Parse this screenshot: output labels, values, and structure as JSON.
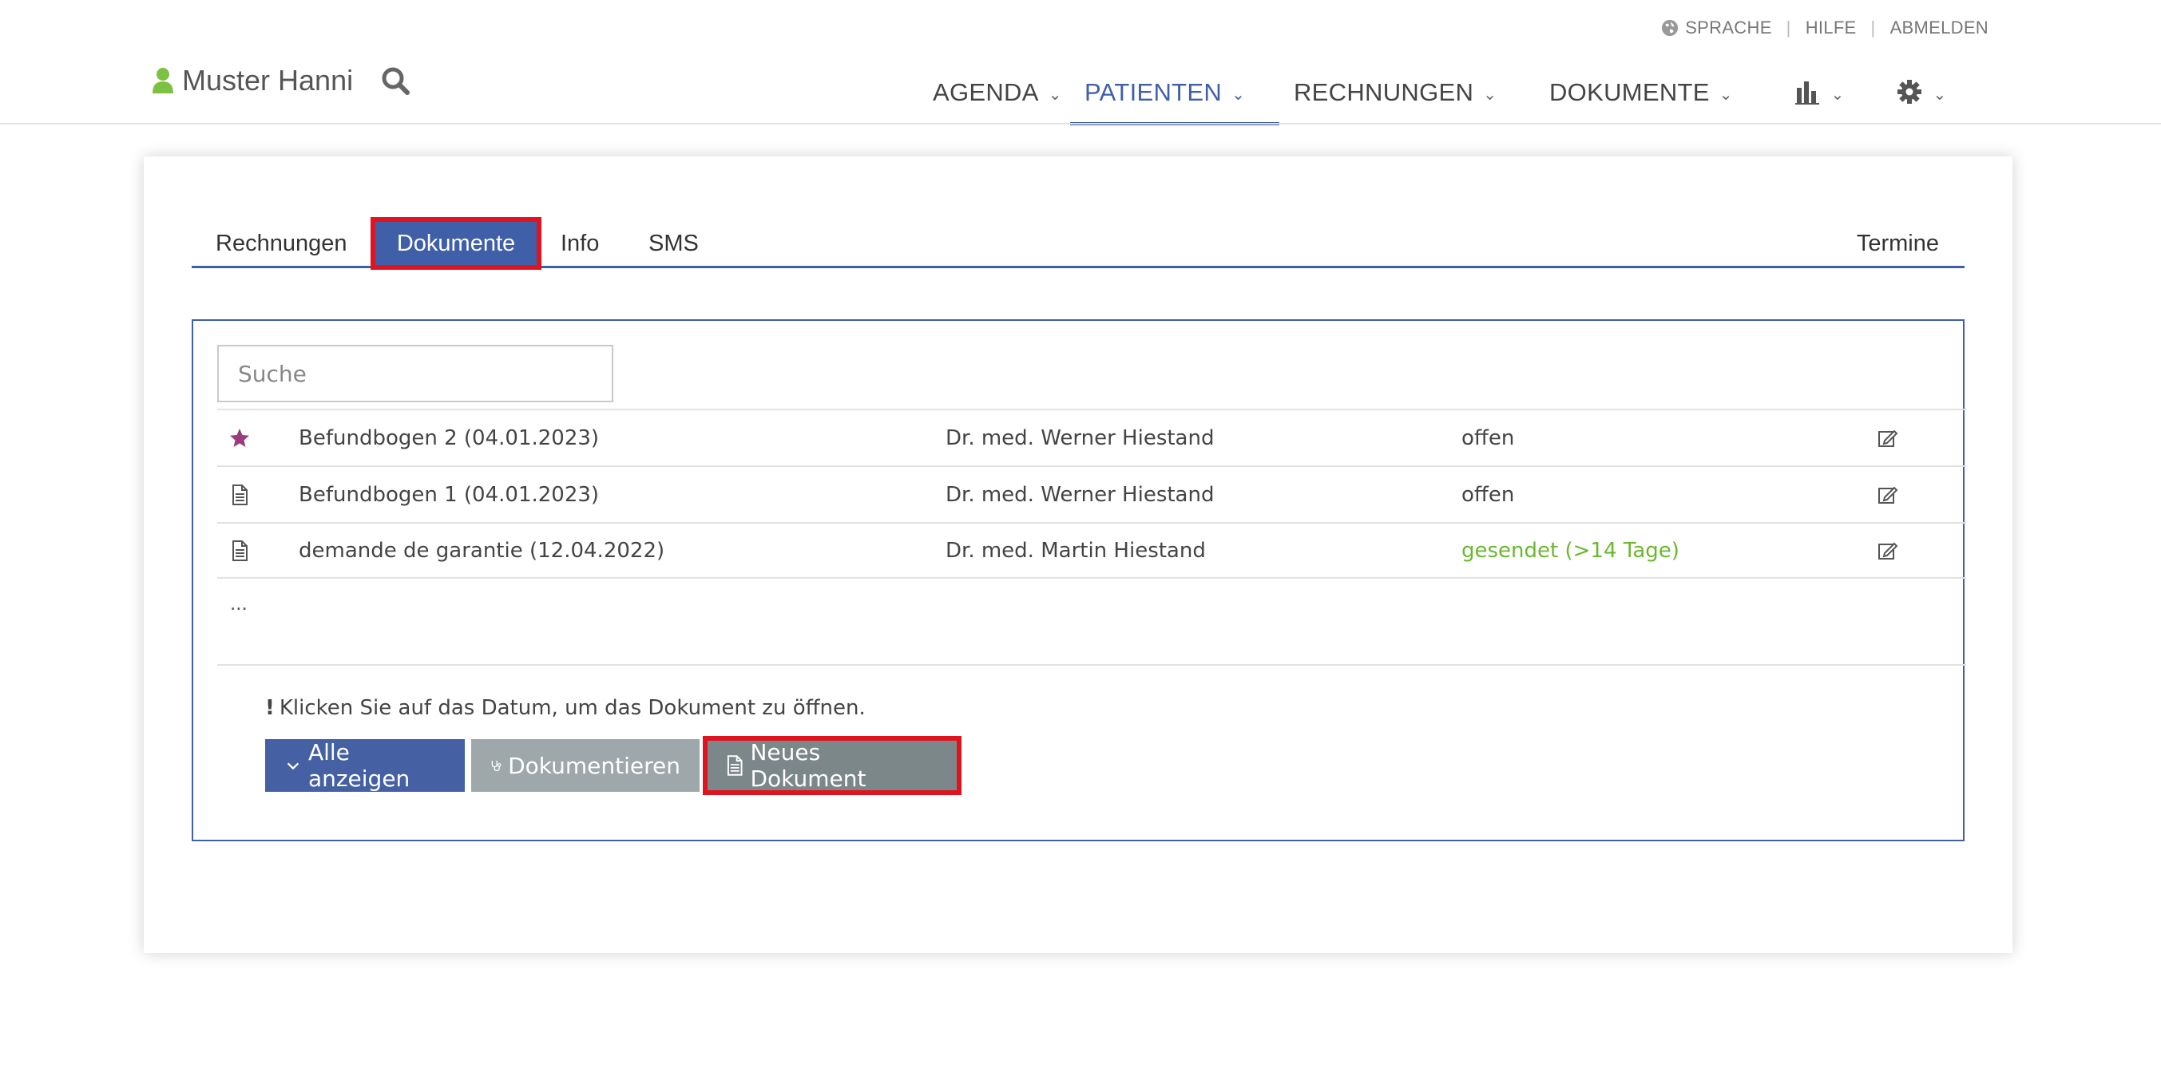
{
  "utility": {
    "language": "SPRACHE",
    "help": "HILFE",
    "logout": "ABMELDEN",
    "separator": "|"
  },
  "user": {
    "name": "Muster Hanni"
  },
  "nav": {
    "agenda": "AGENDA",
    "patients": "PATIENTEN",
    "invoices": "RECHNUNGEN",
    "documents": "DOKUMENTE",
    "chevron": "⌄"
  },
  "tabs": {
    "invoices": "Rechnungen",
    "documents": "Dokumente",
    "info": "Info",
    "sms": "SMS",
    "appointments": "Termine"
  },
  "search": {
    "placeholder": "Suche"
  },
  "documents": [
    {
      "title": "Befundbogen 2 (04.01.2023)",
      "author": "Dr. med. Werner Hiestand",
      "status": "offen",
      "icon": "star-icon"
    },
    {
      "title": "Befundbogen 1 (04.01.2023)",
      "author": "Dr. med. Werner Hiestand",
      "status": "offen",
      "icon": "document-icon"
    },
    {
      "title": "demande de garantie (12.04.2022)",
      "author": "Dr. med. Martin Hiestand",
      "status": "gesendet (>14 Tage)",
      "icon": "document-icon"
    }
  ],
  "ellipsis": "...",
  "hint": {
    "mark": "!",
    "text": "Klicken Sie auf das Datum, um das Dokument zu öffnen."
  },
  "buttons": {
    "show_all": "Alle anzeigen",
    "document": "Dokumentieren",
    "new_document": "Neues Dokument"
  },
  "colors": {
    "accent": "#3f5fa8",
    "sent_status": "#6ab82e",
    "user_icon": "#7cc142",
    "star": "#9a3c7e",
    "highlight": "#e0141e"
  }
}
